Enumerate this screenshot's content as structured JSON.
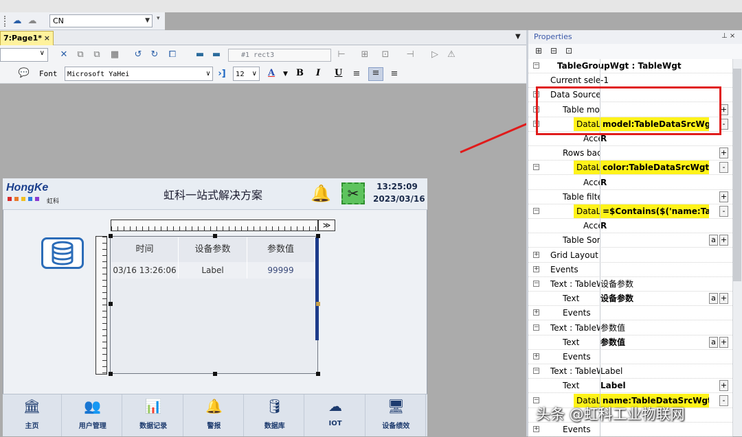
{
  "toolbar": {
    "language": "CN"
  },
  "tab": {
    "label": "7:Page1*",
    "close": "×",
    "menu": "▼"
  },
  "editor": {
    "object_select": "#1 rect3",
    "font_label": "Font",
    "font_value": "Microsoft YaHei",
    "font_size": "12",
    "format_buttons": [
      "A",
      "B",
      "I",
      "U"
    ]
  },
  "hmi": {
    "logo": "HongKe",
    "logo_sub": "虹科",
    "logo_colors": [
      "#d92b2b",
      "#e8792a",
      "#f0c020",
      "#2b7de0",
      "#8a3ad1"
    ],
    "title": "虹科一站式解决方案",
    "time": "13:25:09",
    "date": "2023/03/16",
    "ruler_button": "≫",
    "table": {
      "headers": [
        "时间",
        "设备参数",
        "参数值"
      ],
      "rows": [
        [
          "03/16 13:26:06",
          "Label",
          "99999"
        ]
      ]
    },
    "nav": [
      "主页",
      "用户管理",
      "数据记录",
      "警报",
      "数据库",
      "IOT",
      "设备绩效"
    ],
    "nav_icons": [
      "bank-icon",
      "users-icon",
      "chart-icon",
      "bell-icon",
      "database-icon",
      "cloud-icon",
      "monitor-icon"
    ]
  },
  "properties": {
    "title": "Properties",
    "pin": "⊥ ×",
    "rows": [
      {
        "exp": "−",
        "name": "TableGroupWgt : TableWgt",
        "value": "",
        "bold": true
      },
      {
        "exp": "",
        "name": "Current selecte",
        "value": "-1"
      },
      {
        "exp": "−",
        "name": "Data Source",
        "value": ""
      },
      {
        "exp": "+",
        "name": "Table mode",
        "value": "",
        "btn": [
          "+"
        ]
      },
      {
        "exp": "−",
        "name": "DataLink",
        "value": "model:TableDataSrcWgt",
        "hl": true,
        "btn": [
          "-"
        ]
      },
      {
        "exp": "",
        "name": "Acces",
        "value": "R"
      },
      {
        "exp": "",
        "name": "Rows backg",
        "value": "",
        "btn": [
          "+"
        ]
      },
      {
        "exp": "−",
        "name": "DataLink",
        "value": "color:TableDataSrcWgt",
        "hl": true,
        "btn": [
          "-"
        ]
      },
      {
        "exp": "",
        "name": "Acces",
        "value": "R"
      },
      {
        "exp": "",
        "name": "Table filter",
        "value": "",
        "btn": [
          "+"
        ]
      },
      {
        "exp": "−",
        "name": "DataLink",
        "value": "=$Contains($('name:Tablel",
        "hl": true,
        "btn": [
          "-"
        ]
      },
      {
        "exp": "",
        "name": "Acces",
        "value": "R"
      },
      {
        "exp": "",
        "name": "Table Sortir",
        "value": "",
        "btn": [
          "a",
          "+"
        ]
      },
      {
        "exp": "+",
        "name": "Grid Layout Gr",
        "value": ""
      },
      {
        "exp": "+",
        "name": "Events",
        "value": ""
      },
      {
        "exp": "−",
        "name": "Text : TableW",
        "value": "设备参数"
      },
      {
        "exp": "",
        "name": "Text",
        "value": "设备参数",
        "btn": [
          "a",
          "+"
        ]
      },
      {
        "exp": "+",
        "name": "Events",
        "value": ""
      },
      {
        "exp": "−",
        "name": "Text : TableW",
        "value": "参数值"
      },
      {
        "exp": "",
        "name": "Text",
        "value": "参数值",
        "btn": [
          "a",
          "+"
        ]
      },
      {
        "exp": "+",
        "name": "Events",
        "value": ""
      },
      {
        "exp": "−",
        "name": "Text : TableW",
        "value": "Label"
      },
      {
        "exp": "",
        "name": "Text",
        "value": "Label",
        "btn": [
          "+"
        ]
      },
      {
        "exp": "−",
        "name": "DataLink",
        "value": "name:TableDataSrcWgt",
        "hl": true,
        "btn": [
          "-"
        ]
      },
      {
        "exp": "",
        "name": "",
        "value": ""
      },
      {
        "exp": "+",
        "name": "Events",
        "value": ""
      }
    ]
  },
  "watermark": "头条 @虹科工业物联网"
}
